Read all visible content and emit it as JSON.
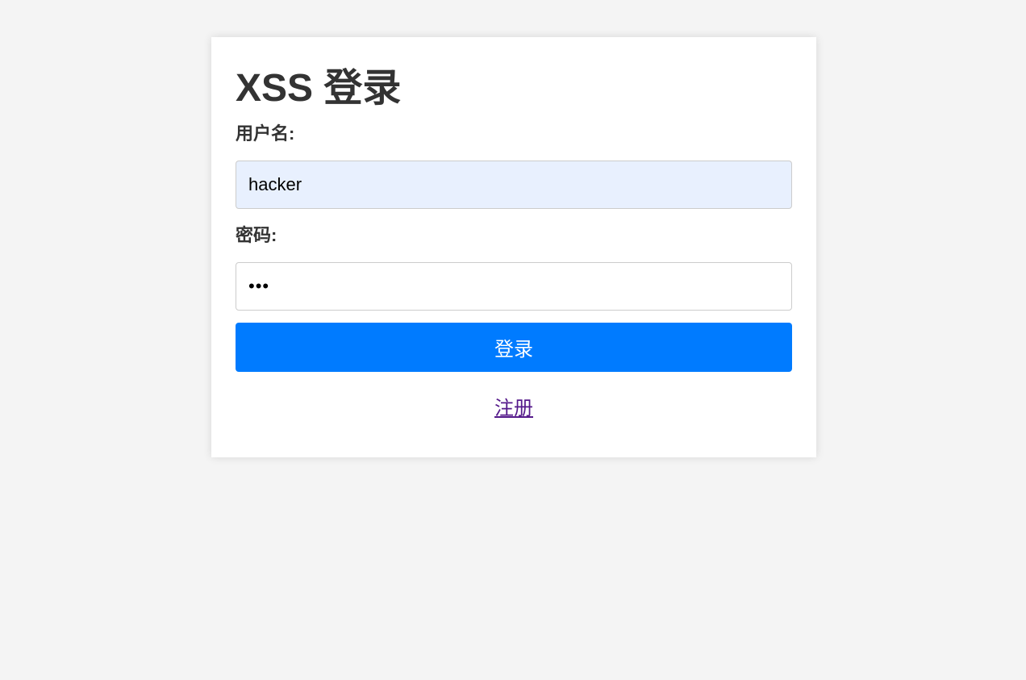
{
  "page": {
    "title": "XSS 登录",
    "colors": {
      "background": "#f4f4f4",
      "card": "#ffffff",
      "button": "#007bff",
      "link": "#551a8b"
    }
  },
  "form": {
    "username_label": "用户名:",
    "username_value": "hacker",
    "password_label": "密码:",
    "password_value": "•••",
    "submit_label": "登录",
    "register_link": "注册"
  }
}
